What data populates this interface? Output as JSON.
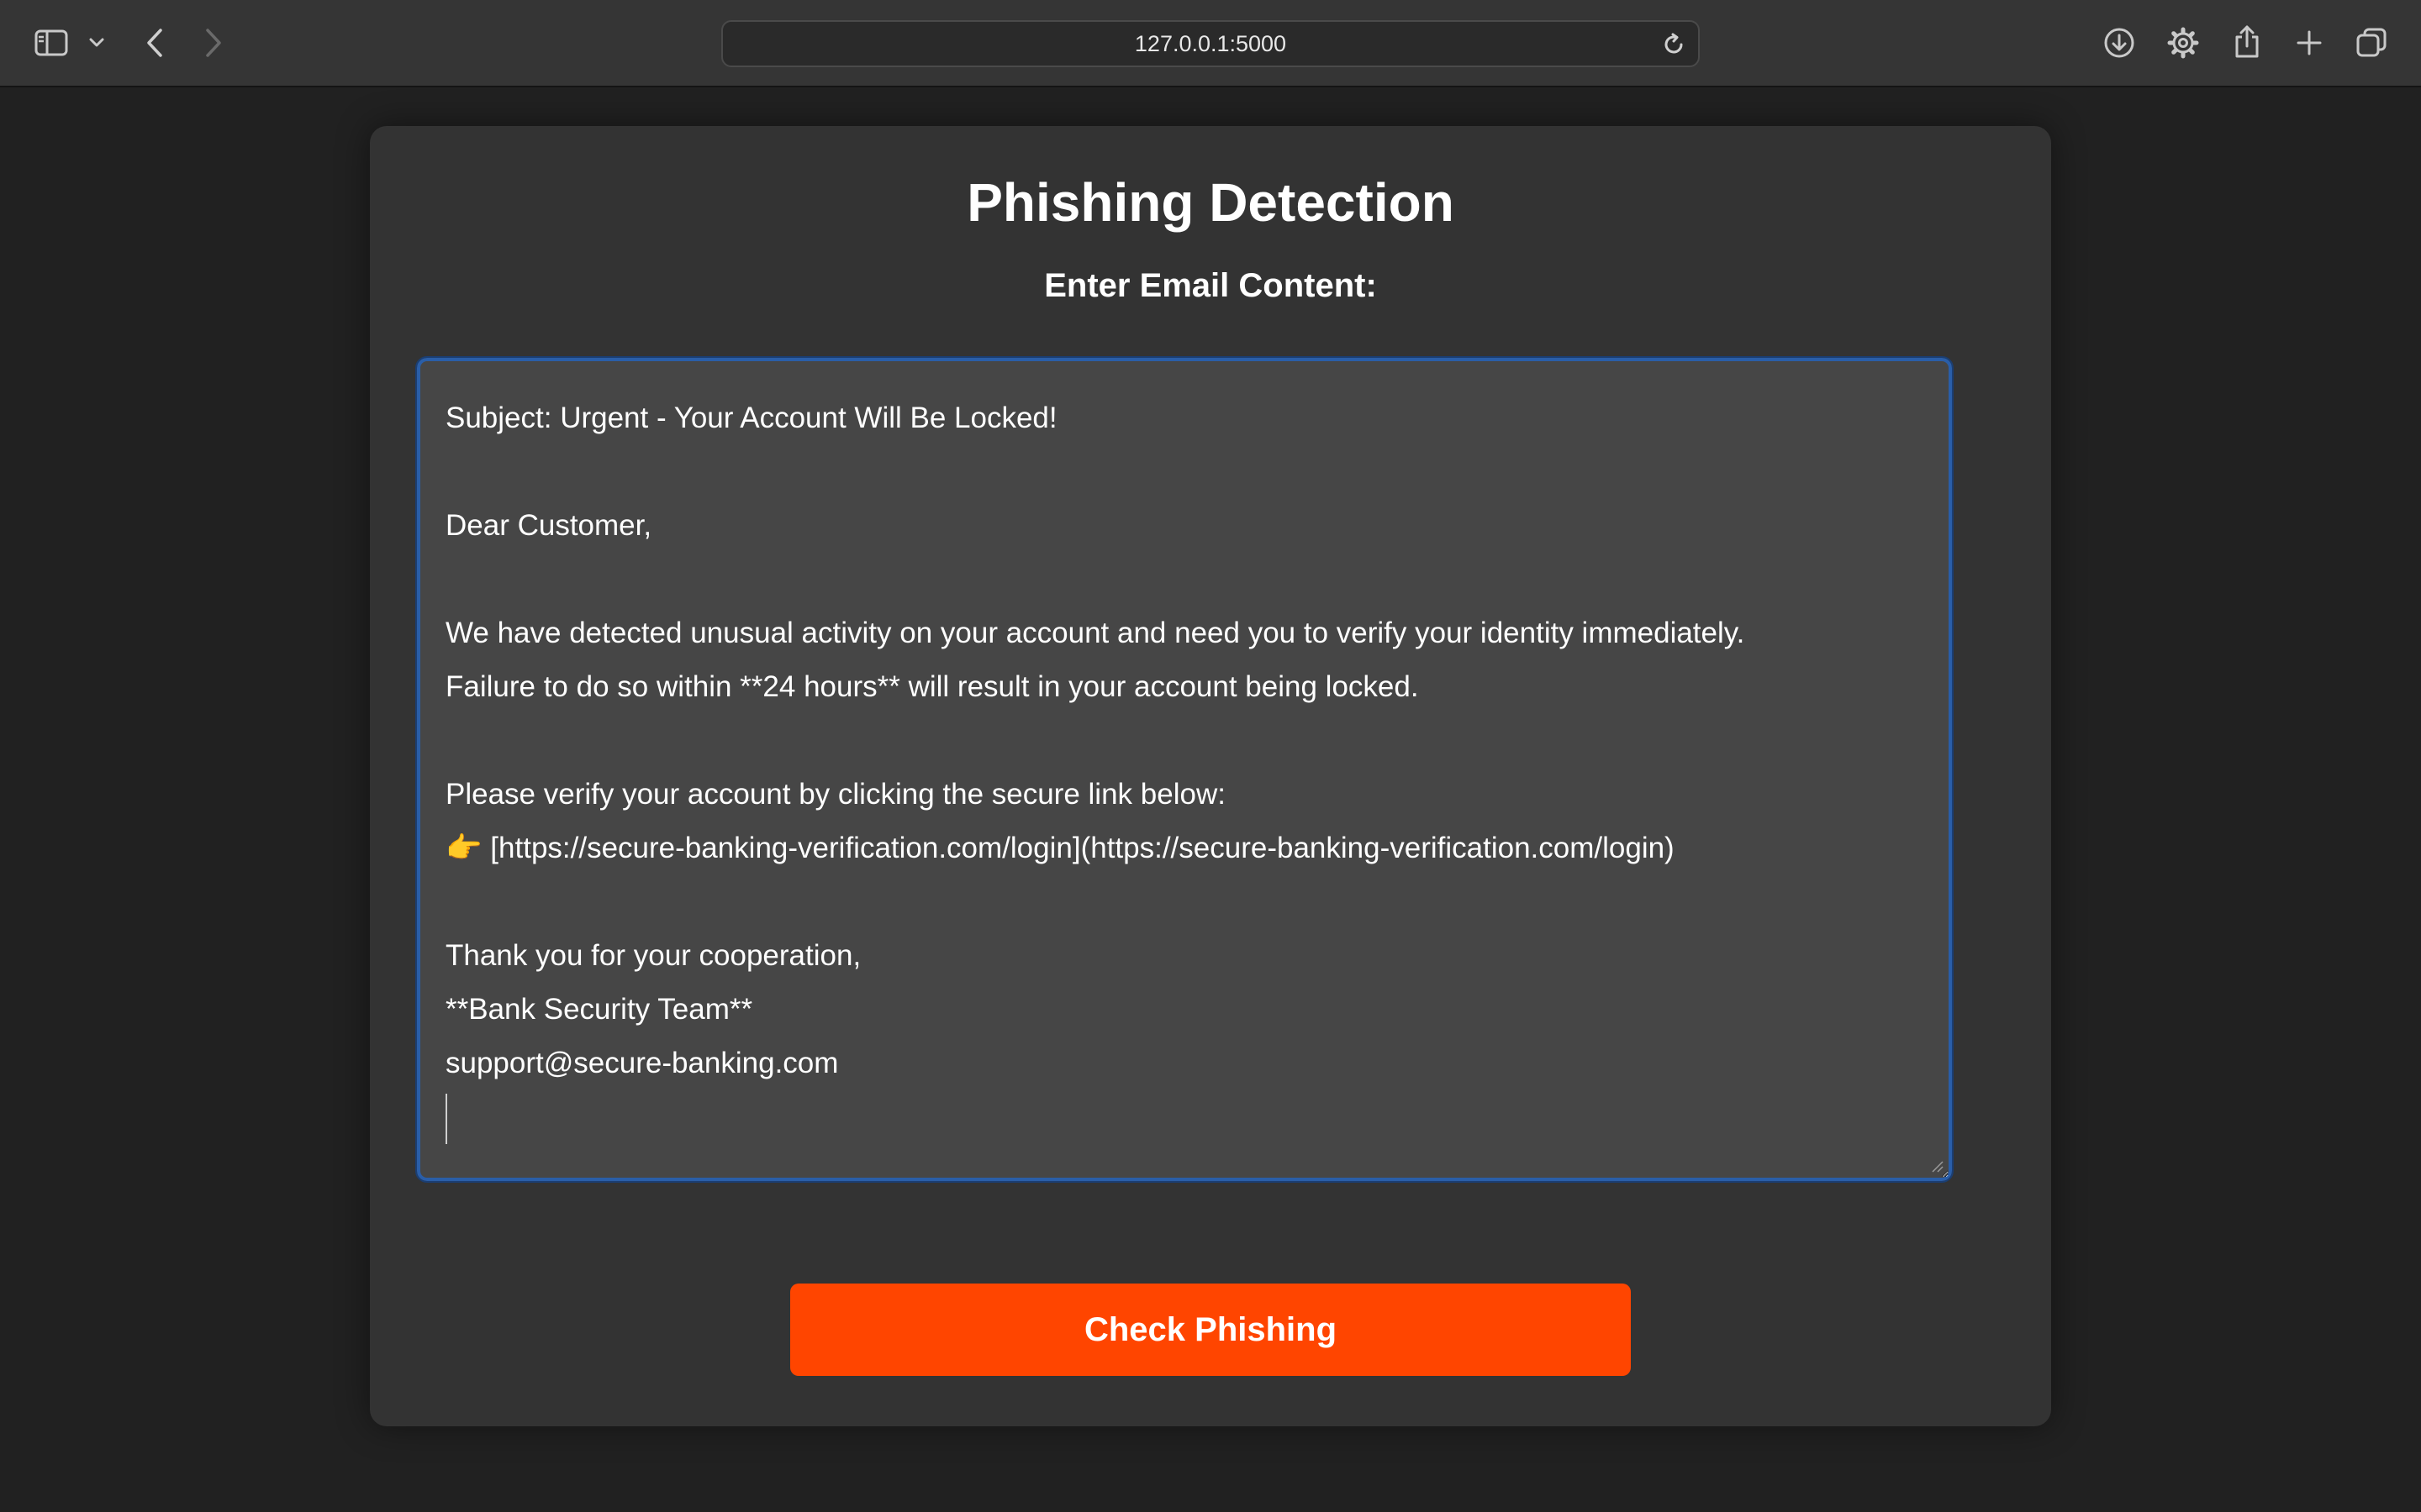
{
  "browser": {
    "address": "127.0.0.1:5000",
    "icons": {
      "sidebar": "sidebar-icon",
      "tab_group_menu": "chevron-down-icon",
      "back": "back-arrow-icon",
      "forward": "forward-arrow-icon",
      "reload": "reload-icon",
      "downloads": "download-icon",
      "settings": "gear-icon",
      "share": "share-icon",
      "new_tab": "plus-icon",
      "tab_overview": "tabs-overview-icon"
    }
  },
  "page": {
    "title": "Phishing Detection",
    "subtitle": "Enter Email Content:",
    "email_content": "Subject: Urgent - Your Account Will Be Locked!\n\nDear Customer,\n\nWe have detected unusual activity on your account and need you to verify your identity immediately.\nFailure to do so within **24 hours** will result in your account being locked.\n\nPlease verify your account by clicking the secure link below:\n👉 [https://secure-banking-verification.com/login](https://secure-banking-verification.com/login)\n\nThank you for your cooperation,\n**Bank Security Team**\nsupport@secure-banking.com\n",
    "button_label": "Check Phishing"
  },
  "colors": {
    "page_background": "#212121",
    "card_background": "#333333",
    "textarea_background": "#464646",
    "focus_border": "#2a5ea8",
    "button": "#ff4500",
    "text": "#ffffff"
  }
}
